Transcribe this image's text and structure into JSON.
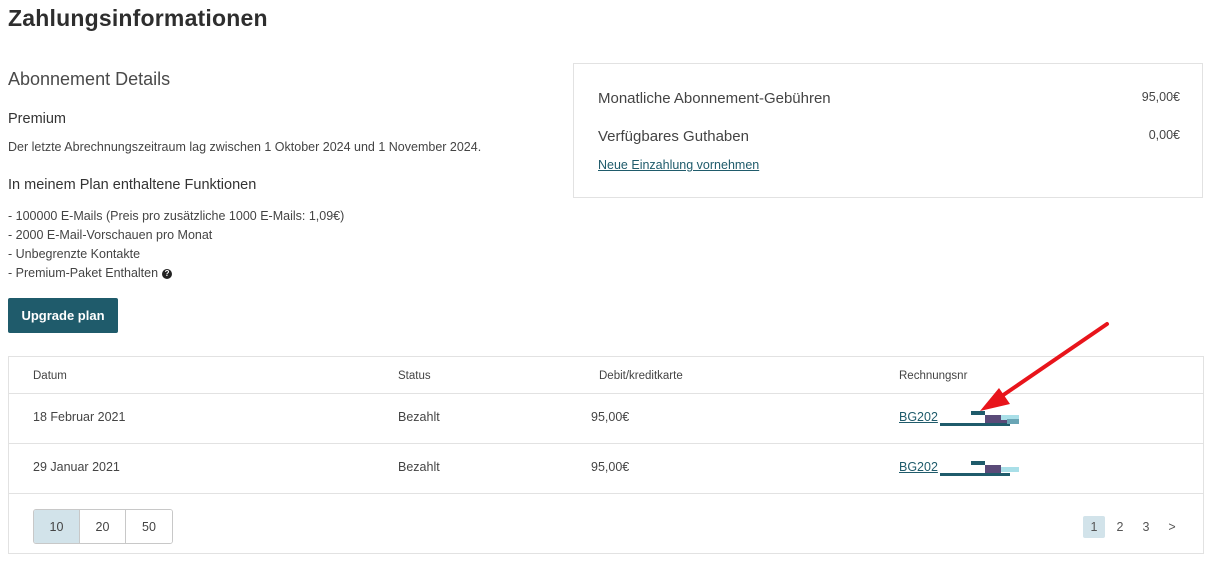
{
  "page": {
    "title": "Zahlungsinformationen"
  },
  "subscription": {
    "section_title": "Abonnement Details",
    "plan_name": "Premium",
    "billing_period_text": "Der letzte Abrechnungszeitraum lag zwischen 1 Oktober 2024 und 1 November 2024.",
    "features_title": "In meinem Plan enthaltene Funktionen",
    "features": [
      "- 100000 E-Mails (Preis pro zusätzliche 1000 E-Mails: 1,09€)",
      "- 2000 E-Mail-Vorschauen pro Monat",
      "- Unbegrenzte Kontakte",
      "- Premium-Paket Enthalten"
    ],
    "help_icon_glyph": "?",
    "upgrade_label": "Upgrade plan"
  },
  "summary": {
    "monthly_fee_label": "Monatliche Abonnement-Gebühren",
    "monthly_fee_value": "95,00€",
    "credit_label": "Verfügbares Guthaben",
    "credit_value": "0,00€",
    "deposit_link": "Neue Einzahlung vornehmen"
  },
  "table": {
    "headers": [
      "Datum",
      "Status",
      "Debit/kreditkarte",
      "Rechnungsnr"
    ],
    "rows": [
      {
        "date": "18 Februar 2021",
        "status": "Bezahlt",
        "amount": "95,00€",
        "invoice": "BG202"
      },
      {
        "date": "29 Januar 2021",
        "status": "Bezahlt",
        "amount": "95,00€",
        "invoice": "BG202"
      }
    ],
    "page_sizes": [
      "10",
      "20",
      "50"
    ],
    "active_page_size": "10",
    "pages": [
      "1",
      "2",
      "3"
    ],
    "active_page": "1",
    "next_glyph": ">"
  },
  "colors": {
    "accent": "#1f5b6b",
    "highlight": "#d2e3ea",
    "annotation_arrow": "#e8141b"
  }
}
